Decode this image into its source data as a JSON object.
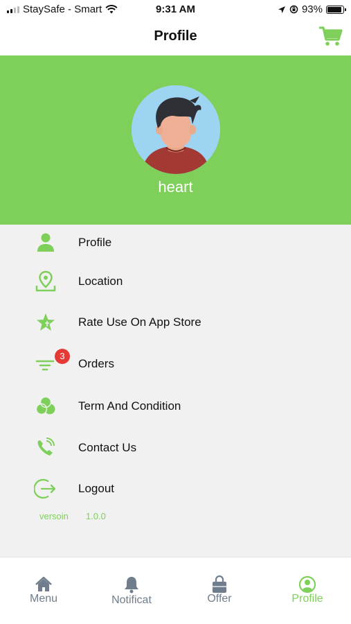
{
  "status_bar": {
    "carrier": "StaySafe - Smart",
    "time": "9:31 AM",
    "battery": "93%",
    "battery_level": 0.93
  },
  "nav": {
    "title": "Profile",
    "cart_icon": "cart-icon"
  },
  "profile": {
    "name": "heart",
    "avatar_icon": "avatar-illustration"
  },
  "menu": {
    "items": [
      {
        "label": "Profile",
        "icon": "person-icon"
      },
      {
        "label": "Location",
        "icon": "location-pin-icon"
      },
      {
        "label": "Rate Use On App Store",
        "icon": "star-icon"
      },
      {
        "label": "Orders",
        "icon": "filter-list-icon",
        "badge": "3"
      },
      {
        "label": "Term And Condition",
        "icon": "circles-icon"
      },
      {
        "label": "Contact Us",
        "icon": "phone-icon"
      },
      {
        "label": "Logout",
        "icon": "logout-icon"
      }
    ]
  },
  "version": {
    "label": "versoin",
    "value": "1.0.0"
  },
  "tabs": [
    {
      "label": "Menu",
      "icon": "home-icon",
      "active": false
    },
    {
      "label": "Notificat",
      "icon": "bell-icon",
      "active": false
    },
    {
      "label": "Offer",
      "icon": "shopping-bag-icon",
      "active": false
    },
    {
      "label": "Profile",
      "icon": "user-circle-icon",
      "active": true
    }
  ],
  "colors": {
    "accent": "#7ed05a",
    "badge": "#e53935",
    "tab_inactive": "#6f7d8c",
    "background": "#f1f1f1"
  }
}
